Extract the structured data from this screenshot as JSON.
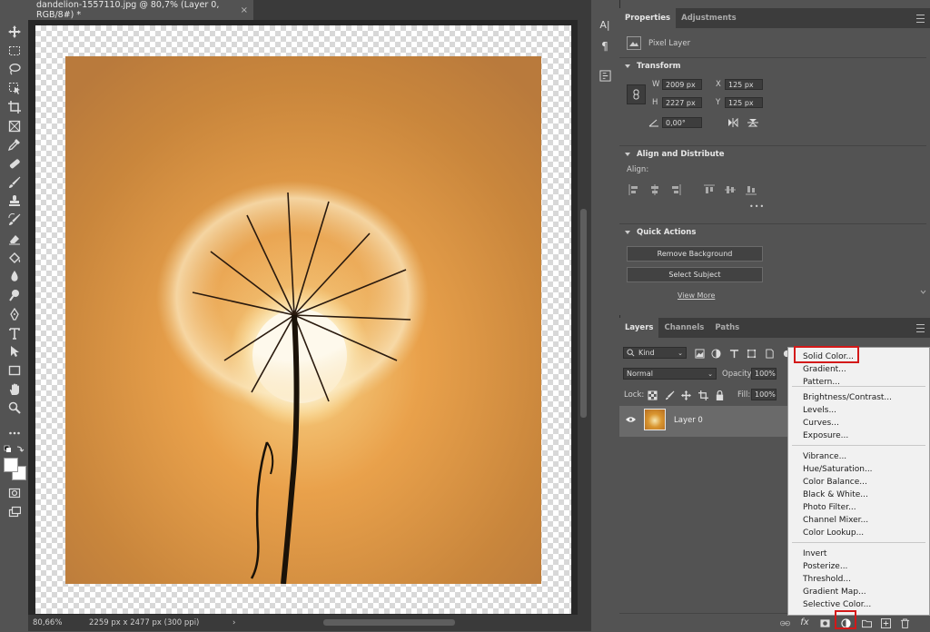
{
  "document": {
    "tab_title": "dandelion-1557110.jpg @ 80,7% (Layer 0, RGB/8#) *",
    "close_glyph": "×"
  },
  "status": {
    "zoom": "80,66%",
    "doc_info": "2259 px x 2477 px (300 ppi)",
    "arrow": "›"
  },
  "tools": [
    {
      "name": "move-tool-icon"
    },
    {
      "name": "marquee-tool-icon"
    },
    {
      "name": "lasso-tool-icon"
    },
    {
      "name": "object-selection-tool-icon"
    },
    {
      "name": "crop-tool-icon"
    },
    {
      "name": "frame-tool-icon"
    },
    {
      "name": "eyedropper-tool-icon"
    },
    {
      "name": "healing-brush-tool-icon"
    },
    {
      "name": "brush-tool-icon"
    },
    {
      "name": "clone-stamp-tool-icon"
    },
    {
      "name": "history-brush-tool-icon"
    },
    {
      "name": "eraser-tool-icon"
    },
    {
      "name": "paint-bucket-tool-icon"
    },
    {
      "name": "blur-tool-icon"
    },
    {
      "name": "dodge-tool-icon"
    },
    {
      "name": "pen-tool-icon"
    },
    {
      "name": "type-tool-icon"
    },
    {
      "name": "path-selection-tool-icon"
    },
    {
      "name": "rectangle-tool-icon"
    },
    {
      "name": "hand-tool-icon"
    },
    {
      "name": "zoom-tool-icon"
    },
    {
      "name": "more-tools-icon"
    }
  ],
  "dock": {
    "char_label": "A|",
    "para_label": "¶"
  },
  "properties": {
    "tab_properties": "Properties",
    "tab_adjustments": "Adjustments",
    "layer_type": "Pixel Layer",
    "transform": {
      "title": "Transform",
      "w_label": "W",
      "w": "2009 px",
      "h_label": "H",
      "h": "2227 px",
      "x_label": "X",
      "x": "125 px",
      "y_label": "Y",
      "y": "125 px",
      "angle": "0,00°"
    },
    "align": {
      "title": "Align and Distribute",
      "align_label": "Align:",
      "more": "•••"
    },
    "quick_actions": {
      "title": "Quick Actions",
      "remove_bg": "Remove Background",
      "select_subject": "Select Subject",
      "view_more": "View More"
    }
  },
  "layers": {
    "tab_layers": "Layers",
    "tab_channels": "Channels",
    "tab_paths": "Paths",
    "kind": "Kind",
    "blend_mode": "Normal",
    "opacity_label": "Opacity:",
    "opacity": "100%",
    "lock_label": "Lock:",
    "fill_label": "Fill:",
    "fill": "100%",
    "layer_name": "Layer 0"
  },
  "adjust_menu": {
    "group1": [
      "Solid Color...",
      "Gradient...",
      "Pattern..."
    ],
    "group2": [
      "Brightness/Contrast...",
      "Levels...",
      "Curves...",
      "Exposure..."
    ],
    "group3": [
      "Vibrance...",
      "Hue/Saturation...",
      "Color Balance...",
      "Black & White...",
      "Photo Filter...",
      "Channel Mixer...",
      "Color Lookup..."
    ],
    "group4": [
      "Invert",
      "Posterize...",
      "Threshold...",
      "Gradient Map...",
      "Selective Color..."
    ]
  },
  "colors": {
    "highlight": "#d31919",
    "panel_bg": "#535353",
    "canvas_bg": "#282828"
  }
}
